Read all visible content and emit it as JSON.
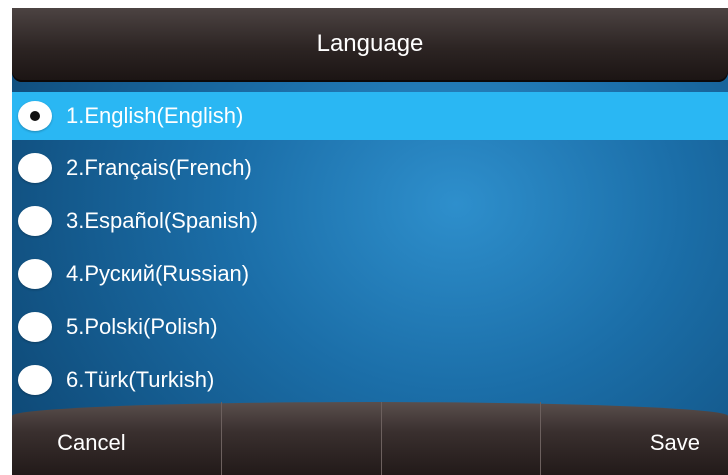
{
  "header": {
    "title": "Language"
  },
  "languages": [
    {
      "label": "1.English(English)",
      "selected": true
    },
    {
      "label": "2.Français(French)",
      "selected": false
    },
    {
      "label": "3.Español(Spanish)",
      "selected": false
    },
    {
      "label": "4.Руский(Russian)",
      "selected": false
    },
    {
      "label": "5.Polski(Polish)",
      "selected": false
    },
    {
      "label": "6.Türk(Turkish)",
      "selected": false
    }
  ],
  "softkeys": {
    "cancel_label": "Cancel",
    "empty_2": "",
    "empty_3": "",
    "save_label": "Save"
  },
  "colors": {
    "selection": "#2ab7f3",
    "background": "#1b6ea8",
    "bar": "#2c2423"
  }
}
